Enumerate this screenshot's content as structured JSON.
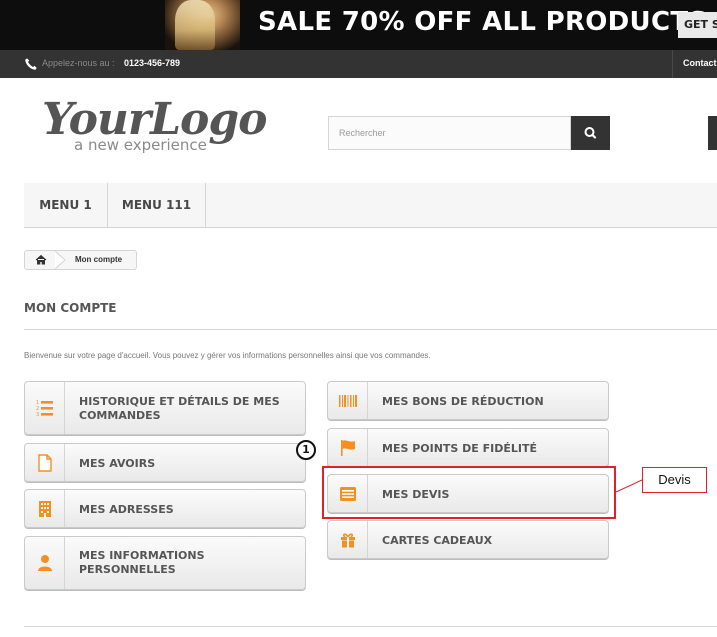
{
  "banner": {
    "headline": "SALE 70% OFF ALL PRODUCTS",
    "cta_label": "GET S"
  },
  "topbar": {
    "call_label": "Appelez-nous au :",
    "phone": "0123-456-789",
    "contact_label": "Contact"
  },
  "logo": {
    "brand": "YourLogo",
    "tagline": "a new experience"
  },
  "search": {
    "placeholder": "Rechercher",
    "icon": "search-icon"
  },
  "menu": {
    "items": [
      {
        "label": "MENU 1"
      },
      {
        "label": "MENU 111"
      }
    ]
  },
  "breadcrumb": {
    "home_icon": "home-icon",
    "current": "Mon compte"
  },
  "page": {
    "title": "MON COMPTE",
    "intro": "Bienvenue sur votre page d'accueil. Vous pouvez y gérer vos informations personnelles ainsi que vos commandes."
  },
  "account_links": {
    "left": [
      {
        "label": "HISTORIQUE ET DÉTAILS DE MES COMMANDES",
        "icon": "list-ordered-icon"
      },
      {
        "label": "MES AVOIRS",
        "icon": "file-icon"
      },
      {
        "label": "MES ADRESSES",
        "icon": "building-icon"
      },
      {
        "label": "MES INFORMATIONS PERSONNELLES",
        "icon": "user-icon"
      }
    ],
    "right": [
      {
        "label": "MES BONS DE RÉDUCTION",
        "icon": "barcode-icon"
      },
      {
        "label": "MES POINTS DE FIDÉLITÉ",
        "icon": "flag-icon"
      },
      {
        "label": "MES DEVIS",
        "icon": "list-alt-icon"
      },
      {
        "label": "CARTES CADEAUX",
        "icon": "gift-icon"
      }
    ]
  },
  "annotation": {
    "step_number": "1",
    "callout_text": "Devis"
  },
  "colors": {
    "accent": "#f58f21",
    "dark": "#333333",
    "callout": "#e0202a"
  }
}
